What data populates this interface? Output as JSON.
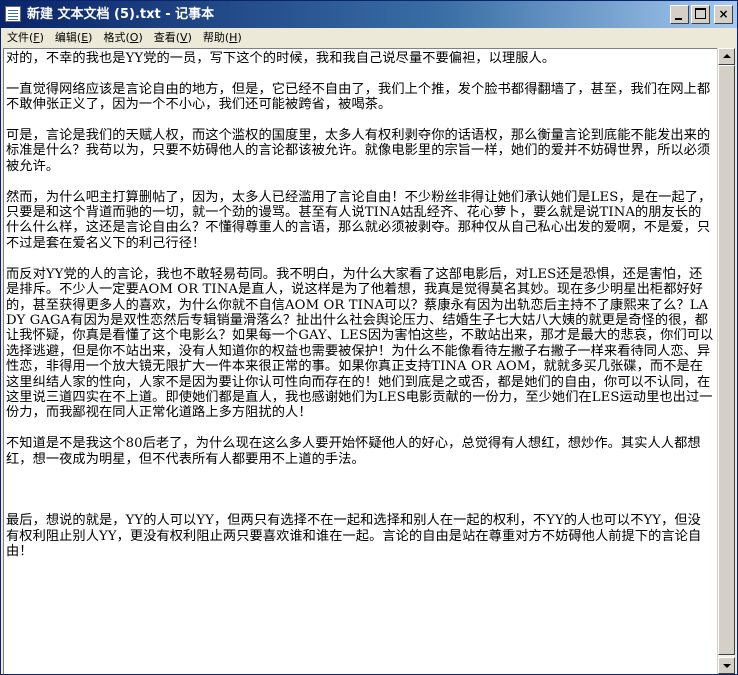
{
  "window": {
    "title": "新建 文本文档 (5).txt - 记事本"
  },
  "icons": {
    "app": "notepad-icon",
    "minimize": "minimize-icon",
    "maximize": "maximize-icon",
    "close": "close-icon",
    "scroll_up": "arrow-up-icon",
    "scroll_down": "arrow-down-icon"
  },
  "colors": {
    "titlebar_start": "#0a246a",
    "titlebar_end": "#a6caf0",
    "chrome": "#ece9d8",
    "editor_bg": "#ffffff"
  },
  "menu": {
    "file": {
      "label": "文件",
      "key": "F"
    },
    "edit": {
      "label": "编辑",
      "key": "E"
    },
    "format": {
      "label": "格式",
      "key": "O"
    },
    "view": {
      "label": "查看",
      "key": "V"
    },
    "help": {
      "label": "帮助",
      "key": "H"
    }
  },
  "buttons": {
    "close_glyph": "×"
  },
  "editor": {
    "text": "对的，不幸的我也是YY党的一员，写下这个的时候，我和我自己说尽量不要偏袒，以理服人。\n\n一直觉得网络应该是言论自由的地方，但是，它已经不自由了，我们上个推，发个脸书都得翻墙了，甚至，我们在网上都不敢伸张正义了，因为一个不小心，我们还可能被跨省，被喝茶。\n\n可是，言论是我们的天赋人权，而这个滥权的国度里，太多人有权利剥夺你的话语权，那么衡量言论到底能不能发出来的标准是什么？我苟以为，只要不妨碍他人的言论都该被允许。就像电影里的宗旨一样，她们的爱并不妨碍世界，所以必须被允许。\n\n然而，为什么吧主打算删帖了，因为，太多人已经滥用了言论自由！不少粉丝非得让她们承认她们是LES，是在一起了，只要是和这个背道而驰的一切，就一个劲的谩骂。甚至有人说TINA姑乱经齐、花心萝卜，要么就是说TINA的朋友长的什么什么样，这还是言论自由么？不懂得尊重人的言语，那么就必须被剥夺。那种仅从自己私心出发的爱啊，不是爱，只不过是套在爱名义下的利己行径！\n\n而反对YY党的人的言论，我也不敢轻易苟同。我不明白，为什么大家看了这部电影后，对LES还是恐惧，还是害怕，还是排斥。不少人一定要AOM OR TINA是直人，说这样是为了他着想，我真是觉得莫名其妙。现在多少明星出柜都好好的，甚至获得更多人的喜欢，为什么你就不自信AOM OR TINA可以？蔡康永有因为出轨恋后主持不了康熙来了么？LADY GAGA有因为是双性恋然后专辑销量滑落么？扯出什么社会舆论压力、结婚生子七大姑八大姨的就更是奇怪的很，都让我怀疑，你真是看懂了这个电影么？如果每一个GAY、LES因为害怕这些，不敢站出来，那才是最大的悲哀，你们可以选择逃避，但是你不站出来，没有人知道你的权益也需要被保护！为什么不能像看待左撇子右撇子一样来看待同人恋、异性恋，非得用一个放大镜无限扩大一件本来很正常的事。如果你真正支持TINA OR AOM，就就多买几张碟，而不是在这里纠结人家的性向，人家不是因为要让你认可性向而存在的！她们到底是之或否，都是她们的自由，你可以不认同，在这里说三道四实在不上道。即使她们都是直人，我也感谢她们为LES电影贡献的一份力，至少她们在LES运动里也出过一份力，而我鄙视在同人正常化道路上多方阻扰的人！\n\n不知道是不是我这个80后老了，为什么现在这么多人要开始怀疑他人的好心，总觉得有人想红，想炒作。其实人人都想红，想一夜成为明星，但不代表所有人都要用不上道的手法。\n\n\n\n最后，想说的就是，YY的人可以YY，但两只有选择不在一起和选择和别人在一起的权利，不YY的人也可以不YY，但没有权利阻止别人YY，更没有权利阻止两只要喜欢谁和谁在一起。言论的自由是站在尊重对方不妨碍他人前提下的言论自由！"
  }
}
